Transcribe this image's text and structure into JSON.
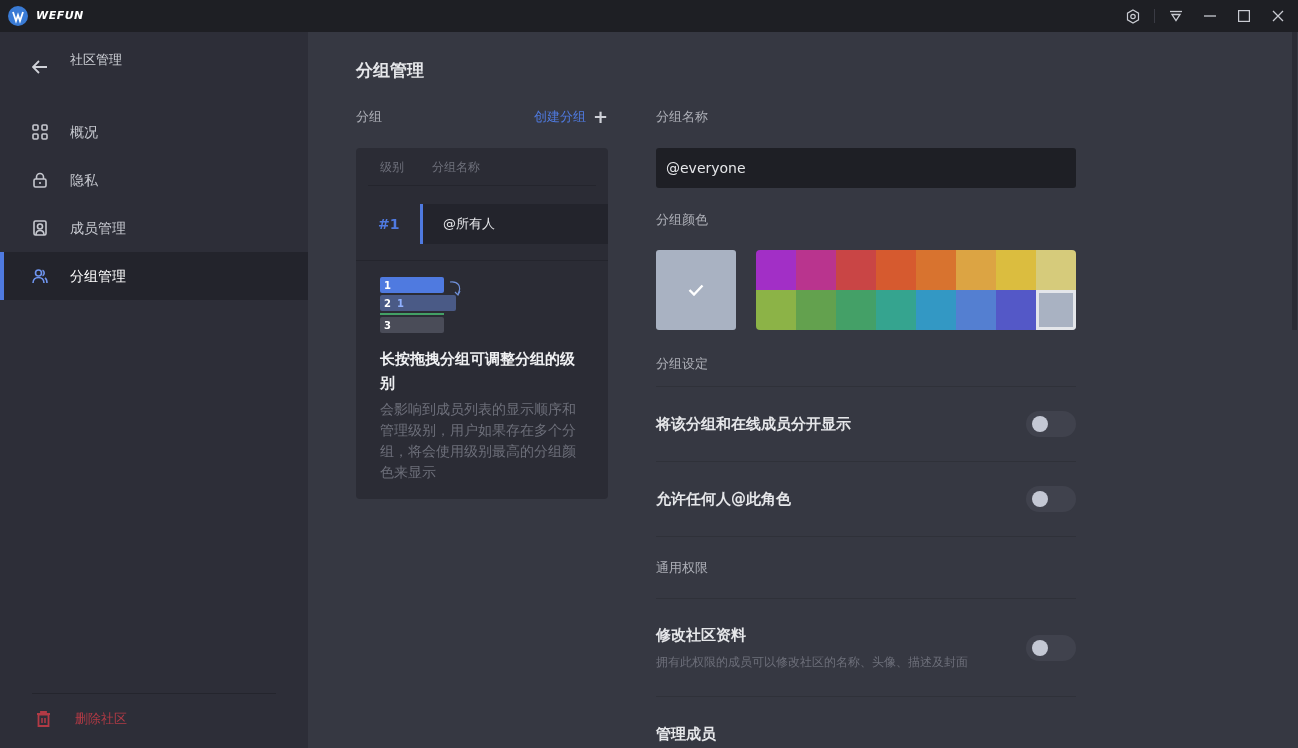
{
  "app": {
    "logo": "WEFUN"
  },
  "sidebar": {
    "title": "社区管理",
    "items": [
      {
        "label": "概况",
        "selected": false
      },
      {
        "label": "隐私",
        "selected": false
      },
      {
        "label": "成员管理",
        "selected": false
      },
      {
        "label": "分组管理",
        "selected": true
      }
    ],
    "delete_label": "删除社区"
  },
  "page_title": "分组管理",
  "groups": {
    "label": "分组",
    "create_label": "创建分组",
    "create_icon": "+",
    "columns": [
      "级别",
      "分组名称"
    ],
    "rows": [
      {
        "rank": "#1",
        "name": "@所有人",
        "selected": true
      }
    ],
    "diagram_labels": [
      "1",
      "2",
      "1",
      "3"
    ],
    "hint_title": "长按拖拽分组可调整分组的级别",
    "hint_body": "会影响到成员列表的显示顺序和管理级别，用户如果存在多个分组，将会使用级别最高的分组颜色来显示"
  },
  "settings": {
    "name_label": "分组名称",
    "name_value": "@everyone",
    "color_label": "分组颜色",
    "colors": [
      {
        "color": "#a22fc6",
        "selected": false
      },
      {
        "color": "#b9348e",
        "selected": false
      },
      {
        "color": "#c94545",
        "selected": false
      },
      {
        "color": "#d65a2f",
        "selected": false
      },
      {
        "color": "#d8732f",
        "selected": false
      },
      {
        "color": "#dca443",
        "selected": false
      },
      {
        "color": "#dbbd3f",
        "selected": false
      },
      {
        "color": "#d6cb7b",
        "selected": false
      },
      {
        "color": "#8cb347",
        "selected": false
      },
      {
        "color": "#63a14e",
        "selected": false
      },
      {
        "color": "#44a067",
        "selected": false
      },
      {
        "color": "#35a48f",
        "selected": false
      },
      {
        "color": "#3398c4",
        "selected": false
      },
      {
        "color": "#547fd1",
        "selected": false
      },
      {
        "color": "#5458c7",
        "selected": false
      },
      {
        "color": "#a9b2c2",
        "selected": true
      }
    ],
    "group_settings_label": "分组设定",
    "toggles": [
      {
        "label": "将该分组和在线成员分开显示",
        "on": false
      },
      {
        "label": "允许任何人@此角色",
        "on": false
      }
    ],
    "permissions_label": "通用权限",
    "permissions": [
      {
        "label": "修改社区资料",
        "description": "拥有此权限的成员可以修改社区的名称、头像、描述及封面",
        "on": false
      },
      {
        "label": "管理成员"
      }
    ]
  }
}
